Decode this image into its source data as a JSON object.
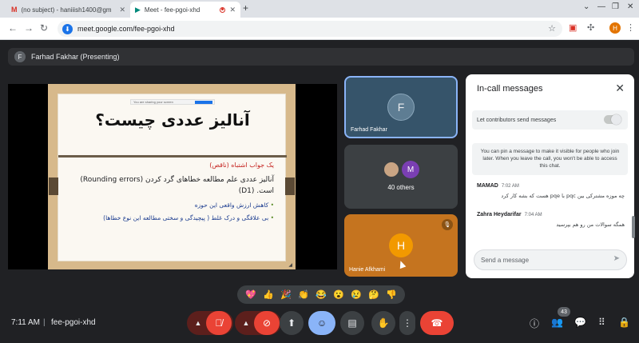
{
  "browser": {
    "tabs": [
      {
        "title": "(no subject) - haniiish1400@gm",
        "active": false
      },
      {
        "title": "Meet - fee-pgoi-xhd",
        "active": true
      }
    ],
    "new_tab": "+",
    "url": "meet.google.com/fee-pgoi-xhd",
    "profile_initial": "H"
  },
  "presenter_bar": {
    "initial": "F",
    "text": "Farhad Fakhar (Presenting)"
  },
  "slide": {
    "mini_bar_text": "You are sharing your screen",
    "title": "آنالیز عددی چیست؟",
    "red_line": "یک جواب اشتباه (ناقص)",
    "body_line1": "آنالیز عددی علم مطالعه خطاهای گرد کردن (Rounding errors)",
    "body_line2": "است. (D1)",
    "bullet1": "کاهش ارزش واقعی این حوزه",
    "bullet2": "بی علاقگی و درک غلط ( پیچیدگی و سختی مطالعه این نوع خطاها)"
  },
  "tiles": [
    {
      "initial": "F",
      "name": "Farhad Fakhar"
    },
    {
      "others_initial": "M",
      "label": "40 others"
    },
    {
      "initial": "H",
      "name": "Hanie Afkhami"
    }
  ],
  "chat": {
    "title": "In-call messages",
    "setting_label": "Let contributors send messages",
    "info_text": "You can pin a message to make it visible for people who join later. When you leave the call, you won't be able to access this chat.",
    "messages": [
      {
        "sender": "MAMAD",
        "time": "7:02 AM",
        "text": "چه موزه مشترکی بین pqc با pqe هست که بشه کار کرد"
      },
      {
        "sender": "Zahra Heydarifar",
        "time": "7:04 AM",
        "text": "همگه سوالات من رو هم بپرسید"
      }
    ],
    "send_placeholder": "Send a message"
  },
  "reactions": [
    "💖",
    "👍",
    "🎉",
    "👏",
    "😂",
    "😮",
    "😢",
    "🤔",
    "👎"
  ],
  "bottom": {
    "time": "7:11 AM",
    "separator": "|",
    "meeting_code": "fee-pgoi-xhd",
    "participant_count": "43"
  }
}
